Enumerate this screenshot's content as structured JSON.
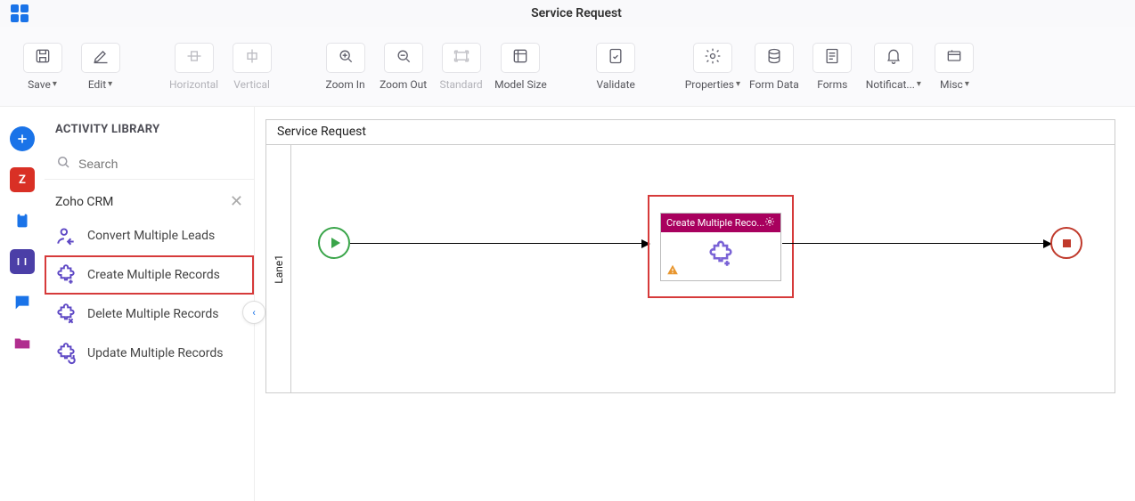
{
  "header": {
    "title": "Service Request"
  },
  "toolbar": {
    "save": "Save",
    "edit": "Edit",
    "horizontal": "Horizontal",
    "vertical": "Vertical",
    "zoom_in": "Zoom In",
    "zoom_out": "Zoom Out",
    "standard": "Standard",
    "model_size": "Model Size",
    "validate": "Validate",
    "properties": "Properties",
    "form_data": "Form Data",
    "forms": "Forms",
    "notifications": "Notificat...",
    "misc": "Misc"
  },
  "sidebar": {
    "title": "ACTIVITY LIBRARY",
    "search_placeholder": "Search",
    "provider": "Zoho CRM",
    "items": [
      {
        "label": "Convert Multiple Leads"
      },
      {
        "label": "Create Multiple Records"
      },
      {
        "label": "Delete Multiple Records"
      },
      {
        "label": "Update Multiple Records"
      }
    ]
  },
  "canvas": {
    "title": "Service Request",
    "lane": "Lane1",
    "task_title": "Create Multiple Reco..."
  }
}
